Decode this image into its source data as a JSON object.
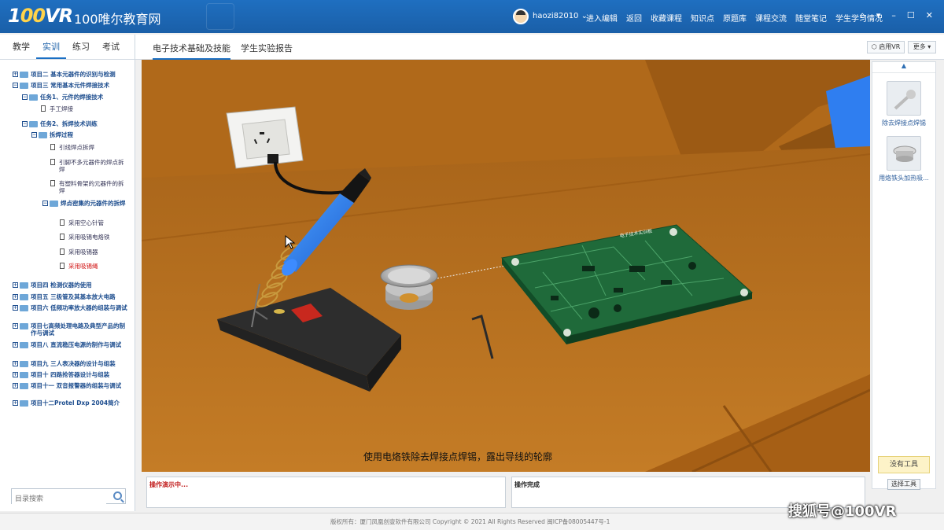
{
  "header": {
    "logo": "100VR",
    "site_name": "100唯尔教育网",
    "username": "haozi82010",
    "nav": [
      "进入编辑",
      "返回",
      "收藏课程",
      "知识点",
      "原题库",
      "课程交流",
      "随堂笔记",
      "学生学习情况"
    ],
    "icons": [
      "home-icon",
      "dropdown-icon",
      "minimize-icon",
      "maximize-icon",
      "close-icon"
    ]
  },
  "left": {
    "tabs": [
      "教学",
      "实训",
      "练习",
      "考试"
    ],
    "active_tab": "实训",
    "tree": [
      "项目二 基本元器件的识别与检测",
      "项目三 常用基本元件焊接技术",
      "任务1、元件的焊接技术",
      "手工焊接",
      "任务2、拆焊技术训练",
      "拆焊过程",
      "引线焊点拆焊",
      "引脚不多元器件的焊点拆焊",
      "有塑料骨架的元器件的拆焊",
      "焊点密集的元器件的拆焊",
      "采用空心针管",
      "采用吸锡电烙铁",
      "采用吸锡器",
      "采用吸锡绳",
      "项目四 检测仪器的使用",
      "项目五 三极管及其基本放大电路",
      "项目六 低频功率放大器的组装与调试",
      "项目七高频处理电路及典型产品的制作与调试",
      "项目八 直流稳压电源的制作与调试",
      "项目九 三人表决器的设计与组装",
      "项目十 四路抢答器设计与组装",
      "项目十一 双音报警器的组装与调试",
      "项目十二Protel Dxp 2004简介"
    ],
    "search_placeholder": "目录搜索"
  },
  "main": {
    "tabs": [
      "电子技术基础及技能",
      "学生实验报告"
    ],
    "vr_button": "启用VR",
    "more_button": "更多",
    "caption": "使用电烙铁除去焊接点焊锡，露出导线的轮廓",
    "pcb_label": "电子技术实训板"
  },
  "tools": {
    "items": [
      "除去焊接点焊锡",
      "用烙铁头加热吸..."
    ],
    "no_tool": "没有工具",
    "select_tool": "选择工具",
    "scroll_up": "▲"
  },
  "status": {
    "left": "操作演示中...",
    "right": "操作完成"
  },
  "footer": "版权所有：厦门凤凰创壹软件有限公司    Copyright © 2021    All Rights Reserved    闽ICP备08005447号-1",
  "watermark": "搜狐号@100VR",
  "colors": {
    "header_bg": "#1a5fa8",
    "table": "#b66f1c",
    "accent_blue": "#2f7ef0",
    "pcb_green": "#1f6a3a",
    "current_item": "#d01010"
  }
}
